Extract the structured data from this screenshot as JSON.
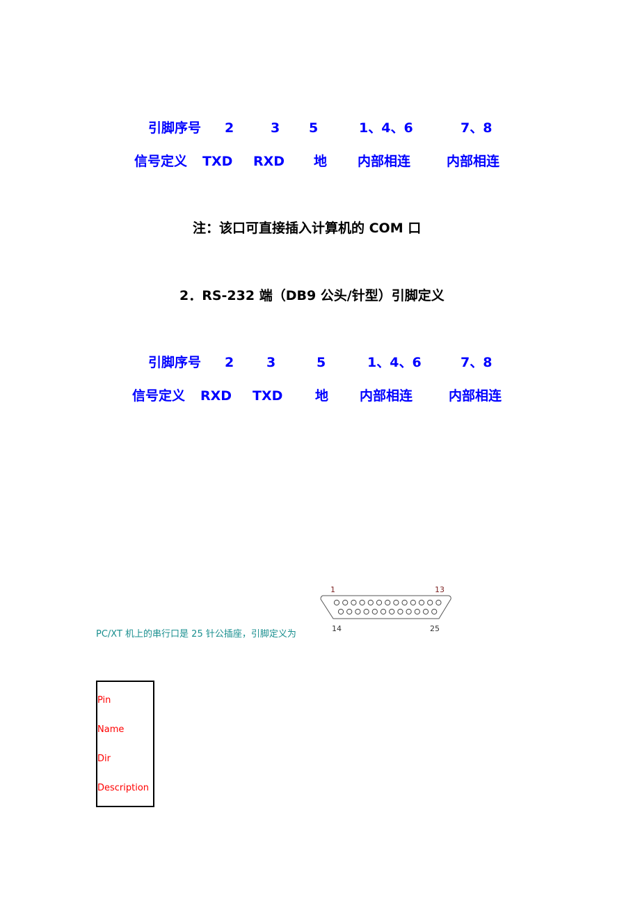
{
  "table1": {
    "pin_label": "引脚序号",
    "pins": [
      "2",
      "3",
      "5",
      "1、4、6",
      "7、8"
    ],
    "sig_label": "信号定义",
    "signals": [
      "TXD",
      "RXD",
      "地",
      "内部相连",
      "内部相连"
    ]
  },
  "note": "注：该口可直接插入计算机的 COM 口",
  "heading": "2．RS-232 端（DB9 公头/针型）引脚定义",
  "table2": {
    "pin_label": "引脚序号",
    "pins": [
      "2",
      "3",
      "5",
      "1、4、6",
      "7、8"
    ],
    "sig_label": "信号定义",
    "signals": [
      "RXD",
      "TXD",
      "地",
      "内部相连",
      "内部相连"
    ]
  },
  "pcxt_text": "PC/XT 机上的串行口是 25 针公插座，引脚定义为",
  "connector": {
    "labels": [
      "1",
      "13",
      "14",
      "25"
    ]
  },
  "pin_table": {
    "headers": [
      "Pin",
      "Name",
      "Dir",
      "Description"
    ]
  },
  "colors": {
    "blue_text": "#0000ff",
    "teal_text": "#1a8f8f",
    "header_red": "#ff0000"
  }
}
